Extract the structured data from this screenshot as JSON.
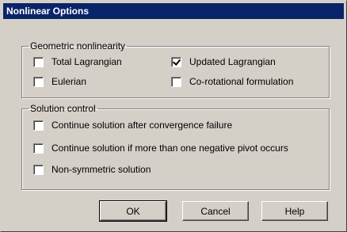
{
  "title": "Nonlinear Options",
  "geometric": {
    "legend": "Geometric nonlinearity",
    "options": [
      {
        "label": "Total Lagrangian",
        "checked": false
      },
      {
        "label": "Updated Lagrangian",
        "checked": true
      },
      {
        "label": "Eulerian",
        "checked": false
      },
      {
        "label": "Co-rotational formulation",
        "checked": false
      }
    ]
  },
  "solution": {
    "legend": "Solution control",
    "options": [
      {
        "label": "Continue solution after convergence failure",
        "checked": false
      },
      {
        "label": "Continue solution if more than one negative pivot occurs",
        "checked": false
      },
      {
        "label": "Non-symmetric solution",
        "checked": false
      }
    ]
  },
  "buttons": {
    "ok": "OK",
    "cancel": "Cancel",
    "help": "Help"
  }
}
